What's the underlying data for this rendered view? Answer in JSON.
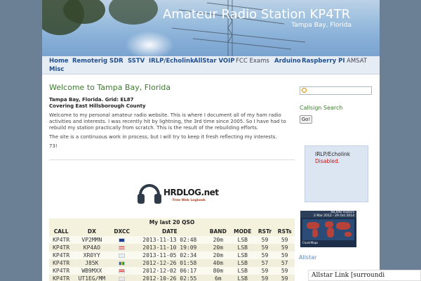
{
  "header": {
    "title": "Amateur Radio Station KP4TR",
    "subtitle": "Tampa Bay, Florida"
  },
  "nav": {
    "items": [
      {
        "label": "Home"
      },
      {
        "label": "Remoterig"
      },
      {
        "label": "SDR"
      },
      {
        "label": "SSTV"
      },
      {
        "label": "IRLP/Echolink"
      },
      {
        "label": "AllStar VOIP"
      },
      {
        "label": "FCC Exams"
      },
      {
        "label": "Arduino"
      },
      {
        "label": "Raspberry PI"
      },
      {
        "label": "AMSAT"
      },
      {
        "label": "Misc"
      }
    ]
  },
  "main": {
    "heading": "Welcome to Tampa Bay, Florida",
    "location_line1": "Tampa Bay, Florida. Grid: EL87",
    "location_line2": "Covering East Hillsborough County",
    "para1": "Welcome to my personal amateur radio website. This is where I document all of my ham radio activities and interests. I was recently hit by lightning, the 3rd time since 2005. So I have had to rebuild my station practically from scratch. This is the result of the rebuilding efforts.",
    "para2": "The site is a continuous work in process, but I will try to keep it fresh reflecting my interests.",
    "signoff": "73!"
  },
  "hrdlog": {
    "brand": "HRDLOG.net",
    "tagline": "Free Web Logbook"
  },
  "qso_table": {
    "caption": "My last 20 QSO",
    "headers": [
      "CALL",
      "DX",
      "DXCC",
      "DATE",
      "BAND",
      "MODE",
      "RSTr",
      "RSTs"
    ],
    "rows": [
      {
        "call": "KP4TR",
        "dx": "VP2MMN",
        "flag": "montserrat",
        "date": "2013-11-13 02:48",
        "band": "20m",
        "mode": "LSB",
        "rstr": "59",
        "rsts": "59"
      },
      {
        "call": "KP4TR",
        "dx": "KP4AO",
        "flag": "puerto-rico",
        "date": "2013-11-10 19:09",
        "band": "20m",
        "mode": "LSB",
        "rstr": "59",
        "rsts": "59"
      },
      {
        "call": "KP4TR",
        "dx": "XR0YY",
        "flag": "easter-island",
        "date": "2013-11-05 02:34",
        "band": "20m",
        "mode": "LSB",
        "rstr": "59",
        "rsts": "59"
      },
      {
        "call": "KP4TR",
        "dx": "J85K",
        "flag": "st-vincent",
        "date": "2012-12-26 01:58",
        "band": "40m",
        "mode": "LSB",
        "rstr": "57",
        "rsts": "57"
      },
      {
        "call": "KP4TR",
        "dx": "WB9MXX",
        "flag": "usa",
        "date": "2012-12-02 06:17",
        "band": "80m",
        "mode": "LSB",
        "rstr": "59",
        "rsts": "59"
      },
      {
        "call": "KP4TR",
        "dx": "UT1EG/MM",
        "flag": "maritime",
        "date": "2012-10-26 02:55",
        "band": "6m",
        "mode": "LSB",
        "rstr": "59",
        "rsts": "59"
      }
    ]
  },
  "sidebar": {
    "search_placeholder": "",
    "callsign_label": "Callsign Search",
    "go_label": "Go!",
    "irlp_title": "IRLP/Echolink",
    "irlp_status": "Disabled.",
    "clustr_visitors": "48,448 Visitors",
    "clustr_dates": "2 Mar 2012 - 29 Oct 2014",
    "clustr_brand": "ClustrMaps",
    "allstar_label": "Allstar",
    "allstar_link": "Allstar Link [surroundi"
  },
  "colors": {
    "accent_green": "#3c7a2e",
    "nav_link": "#1f4f8f",
    "disabled_red": "#d01010",
    "page_bg": "#6b7f95"
  }
}
